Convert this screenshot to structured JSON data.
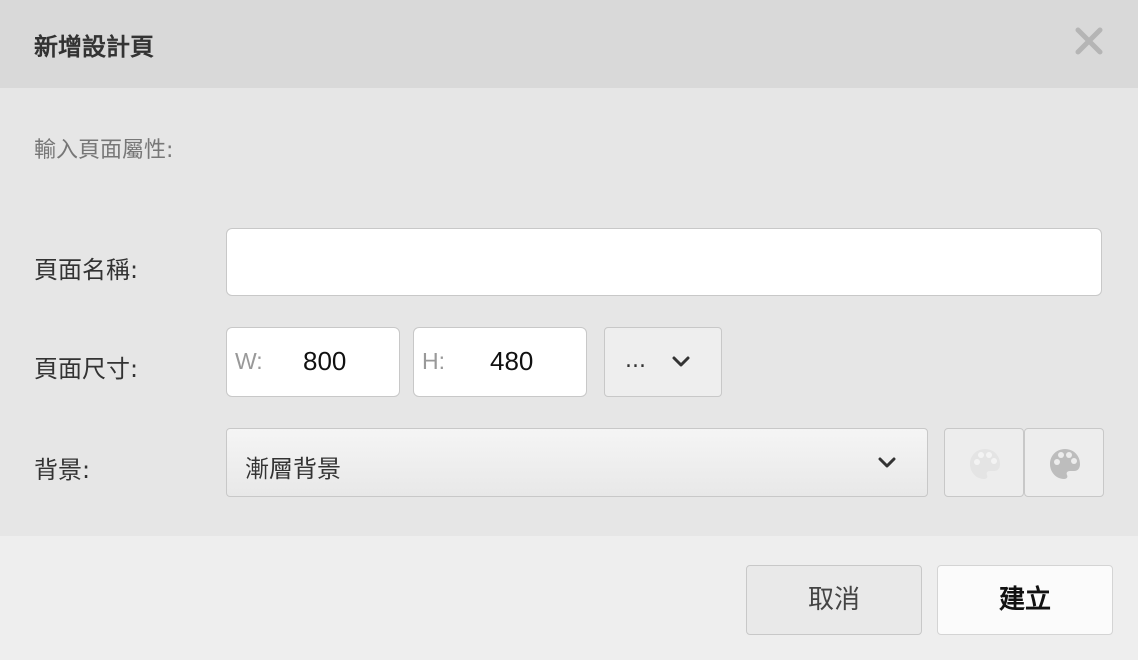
{
  "dialog": {
    "title": "新增設計頁",
    "subtitle": "輸入頁面屬性:"
  },
  "form": {
    "page_name": {
      "label": "頁面名稱:",
      "value": ""
    },
    "page_size": {
      "label": "頁面尺寸:",
      "width_prefix": "W:",
      "width_value": "800",
      "height_prefix": "H:",
      "height_value": "480",
      "more_label": "..."
    },
    "background": {
      "label": "背景:",
      "selected": "漸層背景"
    }
  },
  "footer": {
    "cancel_label": "取消",
    "create_label": "建立"
  },
  "icons": {
    "close": "close-icon",
    "chevron": "chevron-down-icon",
    "palette": "palette-icon"
  }
}
